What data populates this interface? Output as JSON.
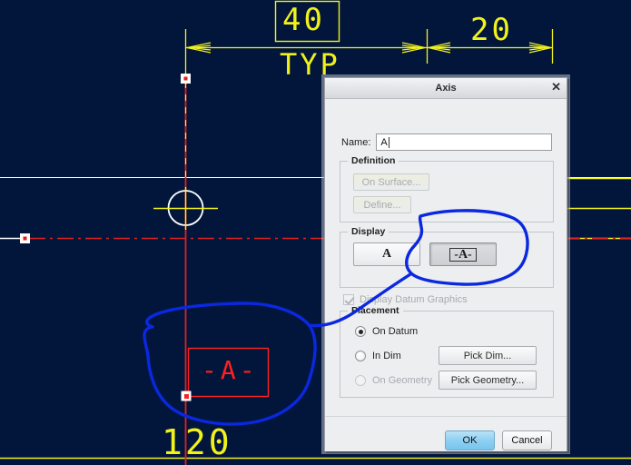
{
  "dialog": {
    "title": "Axis",
    "close_icon": "close-icon",
    "name": {
      "label": "Name:",
      "value": "A",
      "placeholder": ""
    },
    "definition": {
      "legend": "Definition",
      "on_surface_label": "On Surface...",
      "define_label": "Define..."
    },
    "display": {
      "legend": "Display",
      "plain_glyph": "A",
      "datum_glyph": "-A-",
      "selected": "datum"
    },
    "datum_graphics": {
      "label": "Display Datum Graphics",
      "checked": true,
      "enabled": false
    },
    "placement": {
      "legend": "Placement",
      "options": [
        {
          "label": "On Datum",
          "selected": true,
          "enabled": true
        },
        {
          "label": "In Dim",
          "selected": false,
          "enabled": true
        },
        {
          "label": "On Geometry",
          "selected": false,
          "enabled": false
        }
      ],
      "pick_dim_label": "Pick Dim...",
      "pick_geometry_label": "Pick Geometry..."
    },
    "footer": {
      "ok_label": "OK",
      "cancel_label": "Cancel"
    }
  },
  "cad": {
    "background_color": "#02163c",
    "dimension_color": "#f2f21a",
    "datum_color": "#ff2020",
    "centerline_color": "#e02020",
    "annotation_color": "#0a28e0",
    "labels": [
      {
        "name": "dimension-40",
        "text": "40",
        "boxed": true
      },
      {
        "name": "dimension-typ",
        "text": "TYP",
        "boxed": false
      },
      {
        "name": "dimension-20",
        "text": "20",
        "boxed": false
      },
      {
        "name": "dimension-120",
        "text": "120",
        "boxed": false
      }
    ],
    "datum_symbol": {
      "name": "datum-feature-symbol",
      "text": "-A-"
    }
  }
}
